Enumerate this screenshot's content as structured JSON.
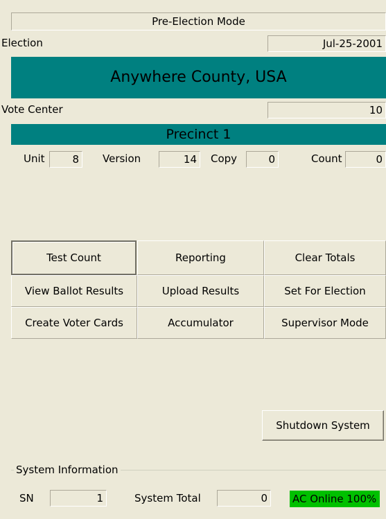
{
  "mode_title": "Pre-Election Mode",
  "election": {
    "label": "Election",
    "date": "Jul-25-2001"
  },
  "county_banner": "Anywhere County, USA",
  "vote_center": {
    "label": "Vote Center",
    "value": "10"
  },
  "precinct_banner": "Precinct 1",
  "unit_info": {
    "unit_label": "Unit",
    "unit_value": "8",
    "version_label": "Version",
    "version_value": "14",
    "copy_label": "Copy",
    "copy_value": "0",
    "count_label": "Count",
    "count_value": "0"
  },
  "buttons": {
    "test_count": "Test Count",
    "reporting": "Reporting",
    "clear_totals": "Clear Totals",
    "view_ballot_results": "View Ballot Results",
    "upload_results": "Upload Results",
    "set_for_election": "Set For Election",
    "create_voter_cards": "Create Voter Cards",
    "accumulator": "Accumulator",
    "supervisor_mode": "Supervisor Mode",
    "shutdown_system": "Shutdown System"
  },
  "system_info": {
    "title": "System Information",
    "sn_label": "SN",
    "sn_value": "1",
    "total_label": "System Total",
    "total_value": "0",
    "power_status": "AC Online 100%"
  },
  "colors": {
    "banner": "#008080",
    "status_ok": "#00c000",
    "window_bg": "#ece9d8"
  }
}
